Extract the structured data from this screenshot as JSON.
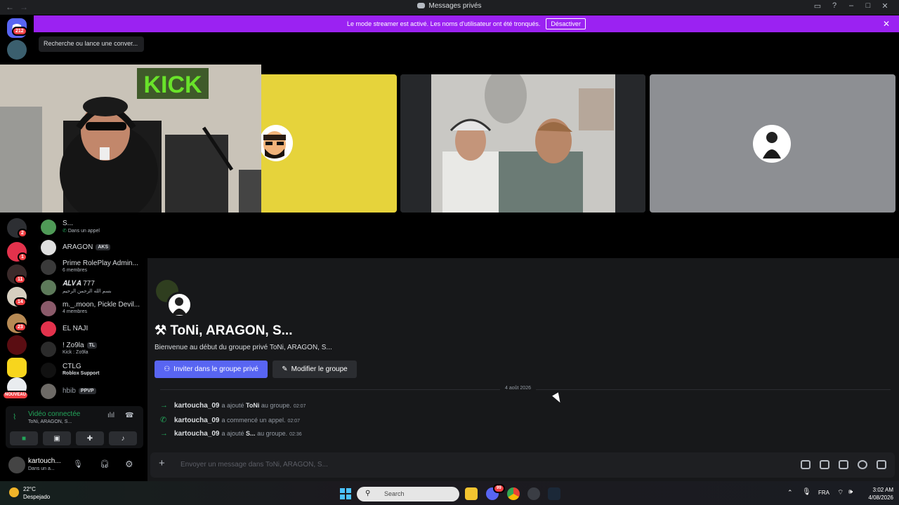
{
  "titlebar": {
    "title": "Messages privés"
  },
  "banner": {
    "text": "Le mode streamer est activé. Les noms d'utilisateur ont été tronqués.",
    "button": "Désactiver"
  },
  "rail": {
    "home_badge": "212",
    "badges": [
      "2",
      "1",
      "11",
      "14",
      "23"
    ],
    "new_label": "NOUVEAU"
  },
  "sidebar": {
    "search_placeholder": "Recherche ou lance une conver...",
    "dms": [
      {
        "name": "S...",
        "sub": "Dans un appel",
        "tag": ""
      },
      {
        "name": "ARAGON",
        "sub": "",
        "tag": "AKS"
      },
      {
        "name": "Prime RolePlay Admin...",
        "sub": "6 membres",
        "tag": ""
      },
      {
        "name": "𝑨𝑳𝑽𝑨 777",
        "sub": "بسم الله الرحمن الرحيم",
        "tag": ""
      },
      {
        "name": "m._.moon, Pickle Devil...",
        "sub": "4 membres",
        "tag": ""
      },
      {
        "name": "EL NAJI",
        "sub": "",
        "tag": ""
      },
      {
        "name": "! Zo9la",
        "sub": "Kick : Zo9la",
        "tag": "TL"
      },
      {
        "name": "CTLG",
        "sub": "Roblox Support",
        "tag": ""
      },
      {
        "name": "hbib",
        "sub": "",
        "tag": "PPVP"
      }
    ]
  },
  "voice": {
    "status": "Vidéo connectée",
    "channel": "ToNi, ARAGON, S..."
  },
  "user": {
    "name": "kartouch...",
    "status": "Dans un a..."
  },
  "chat": {
    "group_title": "ToNi, ARAGON, S...",
    "group_sub": "Bienvenue au début du groupe privé ToNi, ARAGON, S...",
    "invite_button": "Inviter dans le groupe privé",
    "edit_button": "Modifier le groupe",
    "date_divider": "4 août 2026",
    "events": [
      {
        "who": "kartoucha_09",
        "action": "a ajouté",
        "target": "ToNi",
        "suffix": "au groupe.",
        "time": "02:07",
        "icon": "arrow-icon"
      },
      {
        "who": "kartoucha_09",
        "action": "a commencé un appel.",
        "target": "",
        "suffix": "",
        "time": "02:07",
        "icon": "phone-icon"
      },
      {
        "who": "kartoucha_09",
        "action": "a ajouté",
        "target": "S...",
        "suffix": "au groupe.",
        "time": "02:36",
        "icon": "arrow-icon"
      }
    ],
    "composer_placeholder": "Envoyer un message dans ToNi, ARAGON, S..."
  },
  "stream": {
    "sign_text": "KICK"
  },
  "taskbar": {
    "temp": "22°C",
    "weather": "Despejado",
    "search": "Search",
    "discord_badge": "99",
    "lang": "FRA",
    "time": "3:02 AM",
    "date": "4/08/2026"
  },
  "colors": {
    "banner": "#9b22f2",
    "blurple": "#5865f2",
    "green": "#23a55a",
    "red": "#f23f43"
  }
}
